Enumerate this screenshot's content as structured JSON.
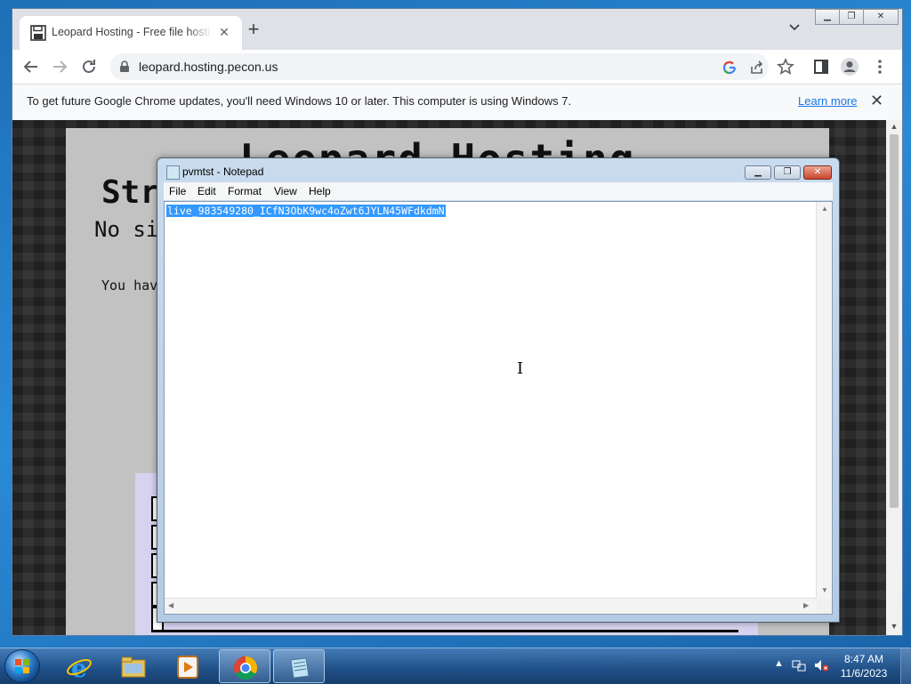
{
  "browser": {
    "tab_title": "Leopard Hosting - Free file hosting",
    "tab_close": "✕",
    "new_tab": "+",
    "url": "leopard.hosting.pecon.us",
    "infobar_message": "To get future Google Chrome updates, you'll need Windows 10 or later. This computer is using Windows 7.",
    "infobar_link": "Learn more",
    "infobar_close": "✕",
    "icons": [
      "back-icon",
      "forward-icon",
      "reload-icon",
      "lock-icon",
      "google-icon",
      "share-icon",
      "star-icon",
      "sidepanel-icon",
      "profile-icon",
      "menu-icon"
    ]
  },
  "webpage": {
    "heading": "Leopard Hosting",
    "subheading": "Str",
    "line": "No si",
    "paragraph": "You hav"
  },
  "notepad": {
    "title": "pvmtst - Notepad",
    "menu": [
      "File",
      "Edit",
      "Format",
      "View",
      "Help"
    ],
    "selected_text": "live_983549280_ICfN3ObK9wc4oZwt6JYLN45WFdkdmN"
  },
  "taskbar": {
    "time": "8:47 AM",
    "date": "11/6/2023",
    "apps": [
      "internet-explorer",
      "file-explorer",
      "media-player",
      "chrome",
      "notepad"
    ]
  }
}
